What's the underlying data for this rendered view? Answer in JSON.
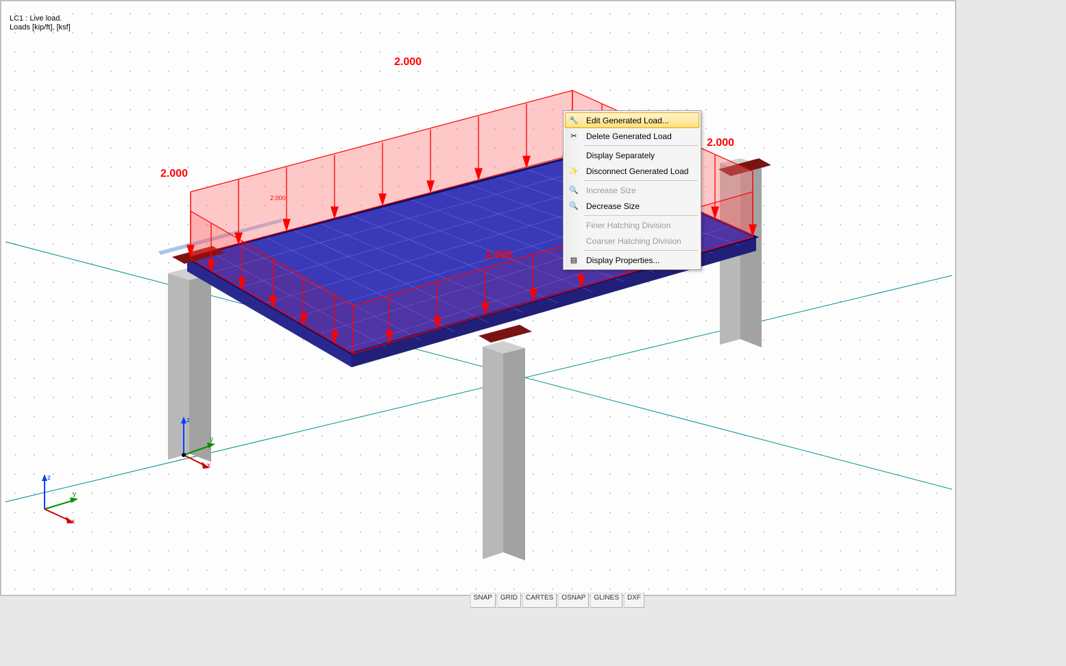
{
  "info": {
    "line1": "LC1 : Live load.",
    "line2": "Loads [kip/ft], [ksf]"
  },
  "load_labels": {
    "top": "2.000",
    "left": "2.000",
    "right": "2.000",
    "center": "2.000",
    "beam_small": "2.000"
  },
  "context_menu": {
    "items": [
      {
        "id": "edit",
        "label": "Edit Generated Load...",
        "icon": "wrench-icon",
        "enabled": true,
        "highlight": true
      },
      {
        "id": "delete",
        "label": "Delete Generated Load",
        "icon": "scissors-icon",
        "enabled": true
      },
      {
        "sep": true
      },
      {
        "id": "dispsep",
        "label": "Display Separately",
        "icon": null,
        "enabled": true
      },
      {
        "id": "disconnect",
        "label": "Disconnect Generated Load",
        "icon": "wand-icon",
        "enabled": true
      },
      {
        "sep": true
      },
      {
        "id": "incsize",
        "label": "Increase Size",
        "icon": "zoom-in-icon",
        "enabled": false
      },
      {
        "id": "decsize",
        "label": "Decrease Size",
        "icon": "zoom-out-icon",
        "enabled": true
      },
      {
        "sep": true
      },
      {
        "id": "finer",
        "label": "Finer Hatching Division",
        "icon": null,
        "enabled": false
      },
      {
        "id": "coarser",
        "label": "Coarser Hatching Division",
        "icon": null,
        "enabled": false
      },
      {
        "sep": true
      },
      {
        "id": "dispprop",
        "label": "Display Properties...",
        "icon": "properties-icon",
        "enabled": true
      }
    ]
  },
  "status": {
    "snap": "SNAP",
    "grid": "GRID",
    "cartes": "CARTES",
    "osnap": "OSNAP",
    "glines": "GLINES",
    "dxf": "DXF"
  },
  "triad": {
    "x": "x",
    "y": "y",
    "z": "z"
  },
  "colors": {
    "load_fill": "rgba(255,130,130,0.45)",
    "load_stroke": "#ff0000",
    "slab": "#3030b0",
    "slab_grid": "#6b6bd8",
    "column": "#b8b8b8",
    "plinth": "#8b1a1a"
  }
}
